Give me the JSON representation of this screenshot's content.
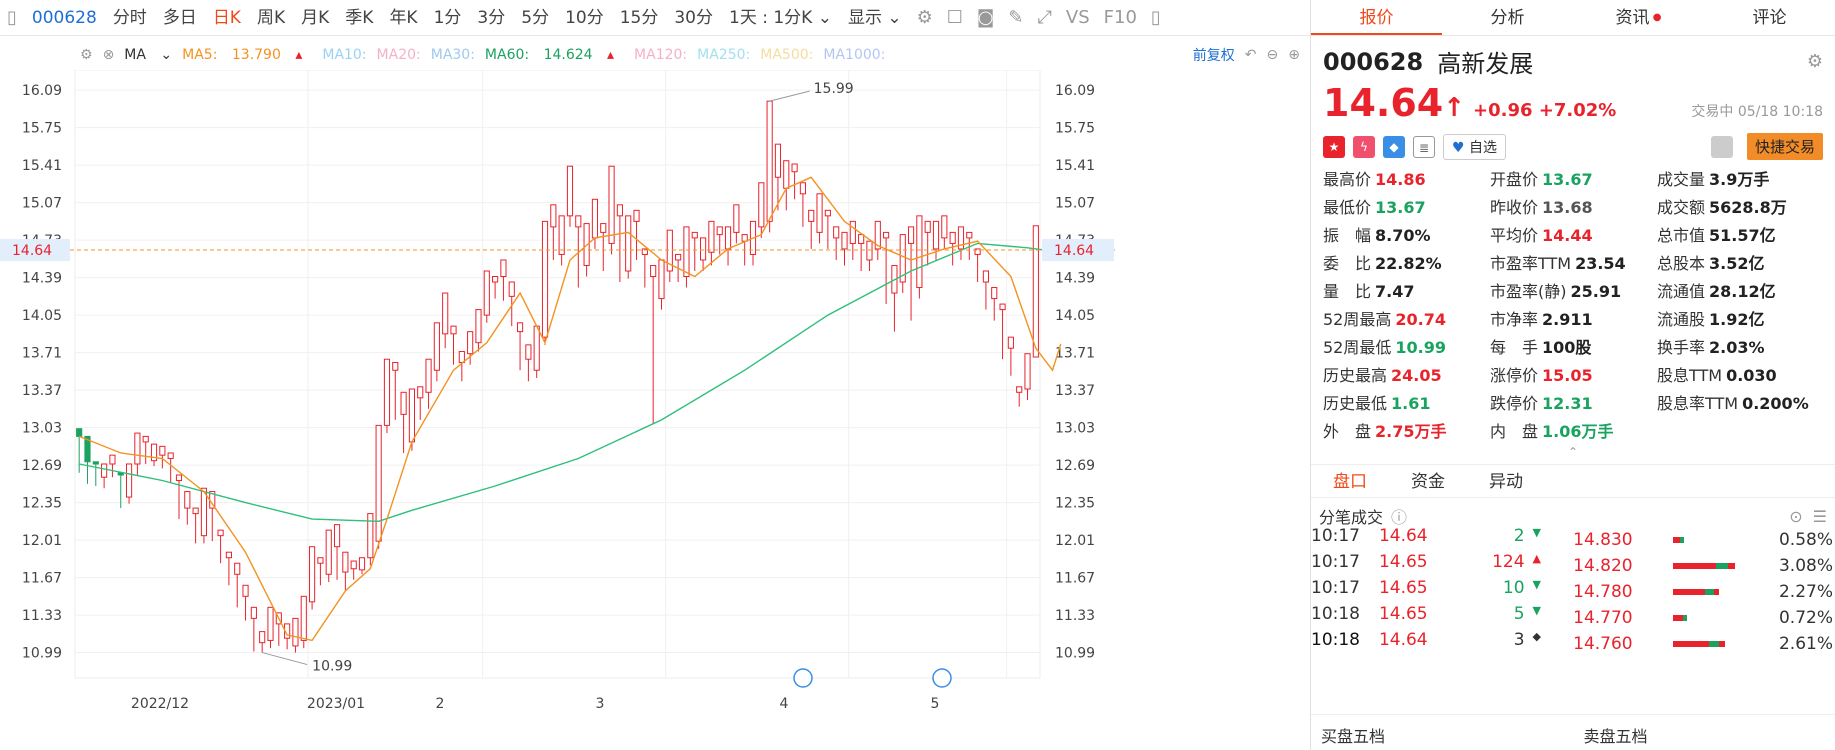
{
  "toolbar": {
    "code": "000628",
    "periods": [
      "分时",
      "多日",
      "日K",
      "周K",
      "月K",
      "季K",
      "年K",
      "1分",
      "3分",
      "5分",
      "10分",
      "15分",
      "30分"
    ],
    "selected_period": "日K",
    "range_label": "1天 : 1分K",
    "display_label": "显示",
    "vs_label": "VS",
    "f10_label": "F10"
  },
  "indicators": {
    "ma_label": "MA",
    "ma5_label": "MA5:",
    "ma5_value": "13.790",
    "ma10_label": "MA10:",
    "ma20_label": "MA20:",
    "ma30_label": "MA30:",
    "ma60_label": "MA60:",
    "ma60_value": "14.624",
    "ma120_label": "MA120:",
    "ma250_label": "MA250:",
    "ma500_label": "MA500:",
    "ma1000_label": "MA1000:",
    "adjust_label": "前复权"
  },
  "colors": {
    "up": "#e8232c",
    "down": "#1aa260",
    "ma5": "#f39322",
    "ma60": "#2fbf7a",
    "accent": "#f04a1a",
    "blue": "#1f6fd1"
  },
  "chart_data": {
    "type": "candlestick",
    "y_ticks": [
      "16.09",
      "15.75",
      "15.41",
      "15.07",
      "14.73",
      "14.39",
      "14.05",
      "13.71",
      "13.37",
      "13.03",
      "12.69",
      "12.35",
      "12.01",
      "11.67",
      "11.33",
      "10.99"
    ],
    "x_labels": [
      "2022/12",
      "2023/01",
      "2",
      "3",
      "4",
      "5"
    ],
    "current_price": "14.64",
    "high_marker": "15.99",
    "low_marker": "10.99",
    "ylim": [
      10.85,
      16.2
    ],
    "candles": [
      [
        13.02,
        12.95,
        12.7,
        12.62
      ],
      [
        12.95,
        12.72,
        12.58,
        12.52
      ],
      [
        12.72,
        12.7,
        12.55,
        12.5
      ],
      [
        12.58,
        12.7,
        12.5,
        12.48
      ],
      [
        12.7,
        12.78,
        12.62,
        12.58
      ],
      [
        12.62,
        12.6,
        12.35,
        12.3
      ],
      [
        12.4,
        12.7,
        12.35,
        12.34
      ],
      [
        12.7,
        12.98,
        12.65,
        12.6
      ],
      [
        12.9,
        12.95,
        12.73,
        12.7
      ],
      [
        12.73,
        12.88,
        12.7,
        12.68
      ],
      [
        12.78,
        12.86,
        12.7,
        12.66
      ],
      [
        12.75,
        12.8,
        12.55,
        12.53
      ],
      [
        12.55,
        12.6,
        12.25,
        12.2
      ],
      [
        12.3,
        12.45,
        12.2,
        12.15
      ],
      [
        12.25,
        12.3,
        12.0,
        11.98
      ],
      [
        12.05,
        12.48,
        12.0,
        11.98
      ],
      [
        12.3,
        12.45,
        12.05,
        12.0
      ],
      [
        12.05,
        12.1,
        11.85,
        11.8
      ],
      [
        11.85,
        11.9,
        11.7,
        11.6
      ],
      [
        11.7,
        11.8,
        11.48,
        11.4
      ],
      [
        11.5,
        11.6,
        11.3,
        11.28
      ],
      [
        11.3,
        11.4,
        11.05,
        11.0
      ],
      [
        11.08,
        11.18,
        11.02,
        10.99
      ],
      [
        11.1,
        11.4,
        11.05,
        11.03
      ],
      [
        11.25,
        11.35,
        11.1,
        11.05
      ],
      [
        11.12,
        11.25,
        11.05,
        11.02
      ],
      [
        11.05,
        11.3,
        11.0,
        10.99
      ],
      [
        11.1,
        11.5,
        11.05,
        11.03
      ],
      [
        11.45,
        11.95,
        11.4,
        11.38
      ],
      [
        11.8,
        11.85,
        11.62,
        11.6
      ],
      [
        11.7,
        12.1,
        11.65,
        11.63
      ],
      [
        11.95,
        12.15,
        11.7,
        11.65
      ],
      [
        11.72,
        11.9,
        11.7,
        11.55
      ],
      [
        11.75,
        11.82,
        11.68,
        11.65
      ],
      [
        11.74,
        11.85,
        11.72,
        11.7
      ],
      [
        11.85,
        12.25,
        11.8,
        11.78
      ],
      [
        12.0,
        13.05,
        11.95,
        11.93
      ],
      [
        13.05,
        13.65,
        13.0,
        12.98
      ],
      [
        13.55,
        13.62,
        13.15,
        13.1
      ],
      [
        13.15,
        13.35,
        12.85,
        12.8
      ],
      [
        12.9,
        13.38,
        12.85,
        12.82
      ],
      [
        13.3,
        13.4,
        13.15,
        13.1
      ],
      [
        13.35,
        13.65,
        13.25,
        13.2
      ],
      [
        13.55,
        13.98,
        13.5,
        13.45
      ],
      [
        13.88,
        14.25,
        13.8,
        13.75
      ],
      [
        13.88,
        13.95,
        13.62,
        13.6
      ],
      [
        13.62,
        13.72,
        13.5,
        13.45
      ],
      [
        13.7,
        13.9,
        13.62,
        13.6
      ],
      [
        13.8,
        14.1,
        13.75,
        13.72
      ],
      [
        14.05,
        14.45,
        14.0,
        13.98
      ],
      [
        14.35,
        14.4,
        14.25,
        14.2
      ],
      [
        14.4,
        14.55,
        14.2,
        14.18
      ],
      [
        14.22,
        14.35,
        14.0,
        13.95
      ],
      [
        13.9,
        13.98,
        13.6,
        13.55
      ],
      [
        13.65,
        13.78,
        13.5,
        13.45
      ],
      [
        13.55,
        13.95,
        13.5,
        13.48
      ],
      [
        13.85,
        14.9,
        13.8,
        13.78
      ],
      [
        14.85,
        15.05,
        14.6,
        14.55
      ],
      [
        14.6,
        14.95,
        14.55,
        14.5
      ],
      [
        14.95,
        15.4,
        14.9,
        14.85
      ],
      [
        14.85,
        14.95,
        14.38,
        14.3
      ],
      [
        14.5,
        14.88,
        14.45,
        14.4
      ],
      [
        14.75,
        15.1,
        14.7,
        14.65
      ],
      [
        14.8,
        14.88,
        14.55,
        14.45
      ],
      [
        14.7,
        15.4,
        14.65,
        14.6
      ],
      [
        14.95,
        15.05,
        14.4,
        14.35
      ],
      [
        14.45,
        14.95,
        14.4,
        14.38
      ],
      [
        14.9,
        15.0,
        14.6,
        14.55
      ],
      [
        14.6,
        14.65,
        14.35,
        14.3
      ],
      [
        14.4,
        14.5,
        14.1,
        13.06
      ],
      [
        14.2,
        14.55,
        14.15,
        14.1
      ],
      [
        14.45,
        14.82,
        14.4,
        14.35
      ],
      [
        14.55,
        14.6,
        14.4,
        14.35
      ],
      [
        14.4,
        14.85,
        14.35,
        14.3
      ],
      [
        14.75,
        14.8,
        14.5,
        14.45
      ],
      [
        14.55,
        14.75,
        14.5,
        14.45
      ],
      [
        14.62,
        14.9,
        14.55,
        14.5
      ],
      [
        14.78,
        14.85,
        14.62,
        14.6
      ],
      [
        14.65,
        14.85,
        14.55,
        14.5
      ],
      [
        14.8,
        15.05,
        14.75,
        14.7
      ],
      [
        14.72,
        14.78,
        14.55,
        14.5
      ],
      [
        14.6,
        14.9,
        14.55,
        14.5
      ],
      [
        14.85,
        15.25,
        14.8,
        14.75
      ],
      [
        14.9,
        15.99,
        14.85,
        14.8
      ],
      [
        15.3,
        15.6,
        15.05,
        15.0
      ],
      [
        15.2,
        15.45,
        15.05,
        15.0
      ],
      [
        15.35,
        15.42,
        15.15,
        15.1
      ],
      [
        15.15,
        15.25,
        14.9,
        14.85
      ],
      [
        14.9,
        15.0,
        14.7,
        14.65
      ],
      [
        14.8,
        15.15,
        14.75,
        14.7
      ],
      [
        14.95,
        15.0,
        14.7,
        14.65
      ],
      [
        14.75,
        14.85,
        14.6,
        14.55
      ],
      [
        14.65,
        14.8,
        14.55,
        14.5
      ],
      [
        14.7,
        14.9,
        14.6,
        14.55
      ],
      [
        14.7,
        14.78,
        14.5,
        14.45
      ],
      [
        14.55,
        14.72,
        14.48,
        14.45
      ],
      [
        14.65,
        14.9,
        14.6,
        14.55
      ],
      [
        14.75,
        14.8,
        14.2,
        14.15
      ],
      [
        14.25,
        14.5,
        14.2,
        13.9
      ],
      [
        14.35,
        14.78,
        14.3,
        14.25
      ],
      [
        14.7,
        14.85,
        14.05,
        14.0
      ],
      [
        14.3,
        14.95,
        14.25,
        14.2
      ],
      [
        14.8,
        14.9,
        14.55,
        14.5
      ],
      [
        14.65,
        14.9,
        14.6,
        14.55
      ],
      [
        14.75,
        14.95,
        14.7,
        14.65
      ],
      [
        14.7,
        14.8,
        14.55,
        14.5
      ],
      [
        14.65,
        14.85,
        14.6,
        14.55
      ],
      [
        14.75,
        14.8,
        14.6,
        14.55
      ],
      [
        14.6,
        14.65,
        14.4,
        14.35
      ],
      [
        14.35,
        14.45,
        14.15,
        14.1
      ],
      [
        14.2,
        14.3,
        14.05,
        14.0
      ],
      [
        14.1,
        14.15,
        13.7,
        13.65
      ],
      [
        13.75,
        13.85,
        13.55,
        13.5
      ],
      [
        13.35,
        13.4,
        13.25,
        13.22
      ],
      [
        13.38,
        13.7,
        13.3,
        13.28
      ],
      [
        13.67,
        14.86,
        13.67,
        13.67
      ]
    ],
    "ma5": [
      [
        0,
        12.95
      ],
      [
        5,
        12.8
      ],
      [
        10,
        12.75
      ],
      [
        15,
        12.45
      ],
      [
        20,
        11.9
      ],
      [
        25,
        11.15
      ],
      [
        28,
        11.1
      ],
      [
        32,
        11.55
      ],
      [
        35,
        11.75
      ],
      [
        37,
        12.2
      ],
      [
        40,
        12.9
      ],
      [
        45,
        13.55
      ],
      [
        49,
        13.8
      ],
      [
        53,
        14.25
      ],
      [
        56,
        13.8
      ],
      [
        59,
        14.55
      ],
      [
        62,
        14.75
      ],
      [
        66,
        14.8
      ],
      [
        70,
        14.55
      ],
      [
        74,
        14.4
      ],
      [
        78,
        14.65
      ],
      [
        82,
        14.78
      ],
      [
        85,
        15.2
      ],
      [
        88,
        15.3
      ],
      [
        92,
        14.9
      ],
      [
        96,
        14.68
      ],
      [
        100,
        14.55
      ],
      [
        104,
        14.65
      ],
      [
        108,
        14.72
      ],
      [
        112,
        14.4
      ],
      [
        115,
        13.75
      ],
      [
        117,
        13.55
      ],
      [
        118,
        13.79
      ]
    ],
    "ma60": [
      [
        0,
        12.7
      ],
      [
        10,
        12.55
      ],
      [
        20,
        12.35
      ],
      [
        28,
        12.2
      ],
      [
        36,
        12.18
      ],
      [
        40,
        12.28
      ],
      [
        50,
        12.5
      ],
      [
        60,
        12.75
      ],
      [
        70,
        13.1
      ],
      [
        80,
        13.55
      ],
      [
        90,
        14.05
      ],
      [
        100,
        14.45
      ],
      [
        108,
        14.7
      ],
      [
        114,
        14.66
      ],
      [
        118,
        14.62
      ]
    ]
  },
  "quote": {
    "tabs": [
      "报价",
      "分析",
      "资讯",
      "评论"
    ],
    "active_tab": "报价",
    "code": "000628",
    "name": "高新发展",
    "price": "14.64",
    "arrow": "↑",
    "change": "+0.96",
    "change_pct": "+7.02%",
    "status": "交易中 05/18 10:18",
    "watch_label": "自选",
    "trade_label": "快捷交易",
    "stats": [
      {
        "l": "最高价",
        "v": "14.86",
        "c": "up"
      },
      {
        "l": "开盘价",
        "v": "13.67",
        "c": "down"
      },
      {
        "l": "成交量",
        "v": "3.9万手",
        "c": "n"
      },
      {
        "l": "最低价",
        "v": "13.67",
        "c": "down"
      },
      {
        "l": "昨收价",
        "v": "13.68",
        "c": "g"
      },
      {
        "l": "成交额",
        "v": "5628.8万",
        "c": "n"
      },
      {
        "l": "振　幅",
        "v": "8.70%",
        "c": "n"
      },
      {
        "l": "平均价",
        "v": "14.44",
        "c": "up"
      },
      {
        "l": "总市值",
        "v": "51.57亿",
        "c": "n"
      },
      {
        "l": "委　比",
        "v": "22.82%",
        "c": "n"
      },
      {
        "l": "市盈率TTM",
        "v": "23.54",
        "c": "n"
      },
      {
        "l": "总股本",
        "v": "3.52亿",
        "c": "n"
      },
      {
        "l": "量　比",
        "v": "7.47",
        "c": "n"
      },
      {
        "l": "市盈率(静)",
        "v": "25.91",
        "c": "n"
      },
      {
        "l": "流通值",
        "v": "28.12亿",
        "c": "n"
      },
      {
        "l": "52周最高",
        "v": "20.74",
        "c": "up"
      },
      {
        "l": "市净率",
        "v": "2.911",
        "c": "n"
      },
      {
        "l": "流通股",
        "v": "1.92亿",
        "c": "n"
      },
      {
        "l": "52周最低",
        "v": "10.99",
        "c": "down"
      },
      {
        "l": "每　手",
        "v": "100股",
        "c": "n"
      },
      {
        "l": "换手率",
        "v": "2.03%",
        "c": "n"
      },
      {
        "l": "历史最高",
        "v": "24.05",
        "c": "up"
      },
      {
        "l": "涨停价",
        "v": "15.05",
        "c": "up"
      },
      {
        "l": "股息TTM",
        "v": "0.030",
        "c": "n"
      },
      {
        "l": "历史最低",
        "v": "1.61",
        "c": "down"
      },
      {
        "l": "跌停价",
        "v": "12.31",
        "c": "down"
      },
      {
        "l": "股息率TTM",
        "v": "0.200%",
        "c": "n"
      },
      {
        "l": "外　盘",
        "v": "2.75万手",
        "c": "up"
      },
      {
        "l": "内　盘",
        "v": "1.06万手",
        "c": "down"
      }
    ],
    "subtabs": [
      "盘口",
      "资金",
      "异动"
    ],
    "ticks_title": "分笔成交",
    "ticks": [
      {
        "t": "10:17",
        "p": "14.64",
        "q": "2",
        "d": "down"
      },
      {
        "t": "10:17",
        "p": "14.65",
        "q": "124",
        "d": "up"
      },
      {
        "t": "10:17",
        "p": "14.65",
        "q": "10",
        "d": "down"
      },
      {
        "t": "10:18",
        "p": "14.65",
        "q": "5",
        "d": "down"
      },
      {
        "t": "10:18",
        "p": "14.64",
        "q": "3",
        "d": "flat"
      }
    ],
    "depth": [
      {
        "p": "14.830",
        "pct": "0.58%",
        "r": 0.1
      },
      {
        "p": "14.820",
        "pct": "3.08%",
        "r": 0.62
      },
      {
        "p": "14.780",
        "pct": "2.27%",
        "r": 0.46
      },
      {
        "p": "14.770",
        "pct": "0.72%",
        "r": 0.14
      },
      {
        "p": "14.760",
        "pct": "2.61%",
        "r": 0.52
      }
    ],
    "buy5": "买盘五档",
    "sell5": "卖盘五档"
  }
}
